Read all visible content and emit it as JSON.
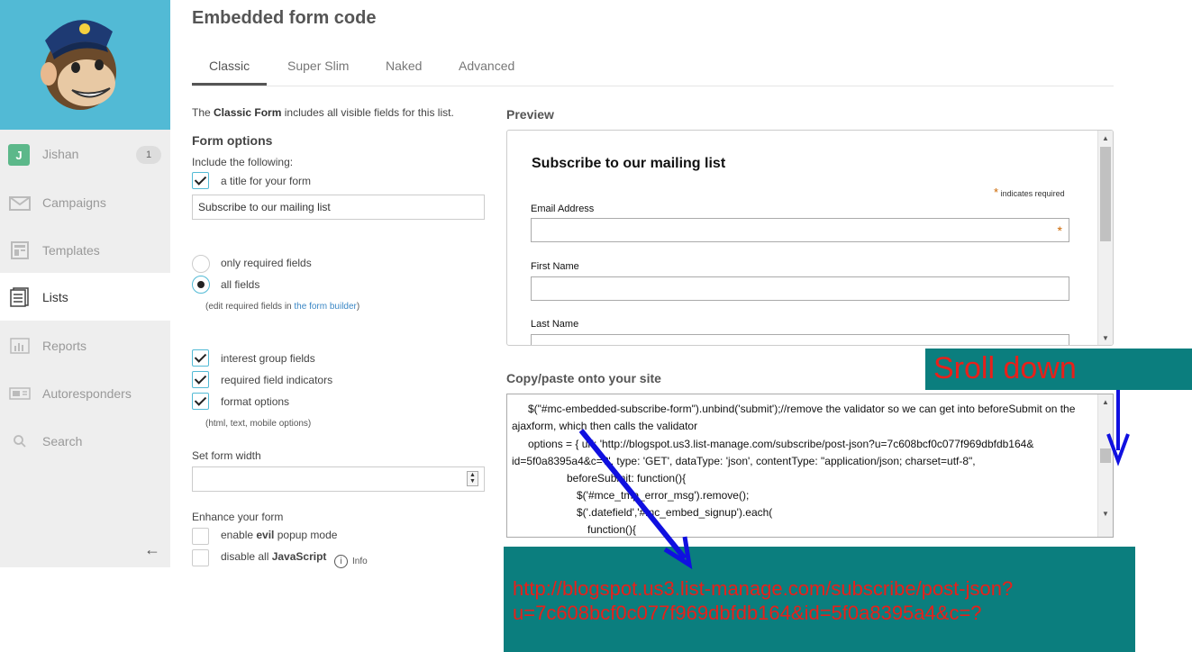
{
  "sidebar": {
    "user": {
      "initial": "J",
      "name": "Jishan",
      "badge": "1"
    },
    "items": [
      {
        "label": "Campaigns",
        "icon": "envelope-icon"
      },
      {
        "label": "Templates",
        "icon": "template-icon"
      },
      {
        "label": "Lists",
        "icon": "list-icon"
      },
      {
        "label": "Reports",
        "icon": "bar-chart-icon"
      },
      {
        "label": "Autoresponders",
        "icon": "autoresponder-icon"
      },
      {
        "label": "Search",
        "icon": "search-icon"
      }
    ],
    "active_item": "Lists",
    "collapse_glyph": "←"
  },
  "header": {
    "title": "Embedded form code"
  },
  "tabs": [
    {
      "label": "Classic"
    },
    {
      "label": "Super Slim"
    },
    {
      "label": "Naked"
    },
    {
      "label": "Advanced"
    }
  ],
  "form_options": {
    "intro_bold": "Classic Form",
    "intro_pre": "The ",
    "intro_post": " includes all visible fields for this list.",
    "heading": "Form options",
    "include_label": "Include the following:",
    "title_checkbox": {
      "label": "a title for your form",
      "checked": true
    },
    "title_value": "Subscribe to our mailing list",
    "radio_required": {
      "label": "only required fields",
      "checked": false
    },
    "radio_all": {
      "label": "all fields",
      "checked": true
    },
    "edit_hint_pre": "(edit required fields in ",
    "edit_hint_link": "the form builder",
    "edit_hint_post": ")",
    "interest_groups": {
      "label": "interest group fields",
      "checked": true
    },
    "required_indicators": {
      "label": "required field indicators",
      "checked": true
    },
    "format_options": {
      "label": "format options",
      "checked": true
    },
    "format_hint": "(html, text, mobile options)",
    "width_label": "Set form width",
    "width_value": "",
    "enhance_label": "Enhance your form",
    "evil_popup": {
      "pre": "enable ",
      "bold": "evil",
      "post": " popup mode",
      "checked": false
    },
    "disable_js": {
      "pre": "disable all ",
      "bold": "JavaScript",
      "checked": false
    },
    "info_label": "Info"
  },
  "preview": {
    "heading": "Preview",
    "form_title": "Subscribe to our mailing list",
    "required_note": "indicates required",
    "fields": [
      {
        "label": "Email Address",
        "required": true
      },
      {
        "label": "First Name",
        "required": false
      },
      {
        "label": "Last Name",
        "required": false
      }
    ]
  },
  "code": {
    "heading": "Copy/paste onto your site",
    "lines": [
      "$(\"#mc-embedded-subscribe-form\").unbind('submit');//remove the validator so we can get into beforeSubmit on the",
      "ajaxform, which then calls the validator",
      "options = { url: 'http://blogspot.us3.list-manage.com/subscribe/post-json?u=7c608bcf0c077f969dbfdb164&",
      "id=5f0a8395a4&c=?', type: 'GET', dataType: 'json', contentType: \"application/json; charset=utf-8\",",
      "beforeSubmit: function(){",
      "$('#mce_tmp_error_msg').remove();",
      "$('.datefield','#mc_embed_signup').each(",
      "function(){"
    ]
  },
  "annotations": {
    "scroll_note": "Sroll down",
    "url_line1": "http://blogspot.us3.list-manage.com/subscribe/post-json?",
    "url_line2": "u=7c608bcf0c077f969dbfdb164&id=5f0a8395a4&c=?",
    "box_color": "#0b7e7e",
    "text_color": "#e8201a",
    "arrow_color": "#1010e0"
  }
}
